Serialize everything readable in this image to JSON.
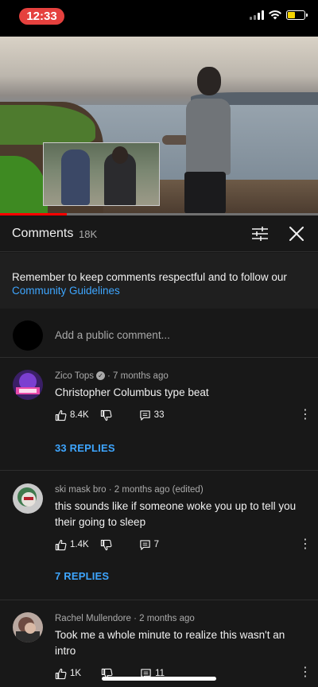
{
  "status_bar": {
    "time": "12:33"
  },
  "video": {
    "progress_fraction": 0.21
  },
  "header": {
    "title": "Comments",
    "count": "18K"
  },
  "notice": {
    "text": "Remember to keep comments respectful and to follow our",
    "link": "Community Guidelines"
  },
  "add_comment": {
    "placeholder": "Add a public comment..."
  },
  "comments": [
    {
      "author": "Zico Tops",
      "verified": true,
      "age": "7 months ago",
      "text": "Christopher Columbus type beat",
      "likes": "8.4K",
      "reply_count": "33",
      "replies_label": "33 REPLIES"
    },
    {
      "author": "ski mask bro",
      "age": "2 months ago (edited)",
      "text": "this sounds like if someone woke you up to tell you their going to sleep",
      "likes": "1.4K",
      "reply_count": "7",
      "replies_label": "7 REPLIES"
    },
    {
      "author": "Rachel Mullendore",
      "age": "2 months ago",
      "text": "Took me a whole minute to realize this wasn't an intro",
      "likes": "1K",
      "reply_count": "11"
    }
  ],
  "colors": {
    "background": "#181818",
    "link_blue": "#3ea6ff",
    "progress_red": "#ff0000",
    "time_pill": "#e5413e"
  },
  "icons": [
    "wifi-icon",
    "battery-icon",
    "filter-icon",
    "close-icon",
    "thumb-up-icon",
    "thumb-down-icon",
    "reply-icon",
    "more-icon",
    "verified-icon"
  ]
}
